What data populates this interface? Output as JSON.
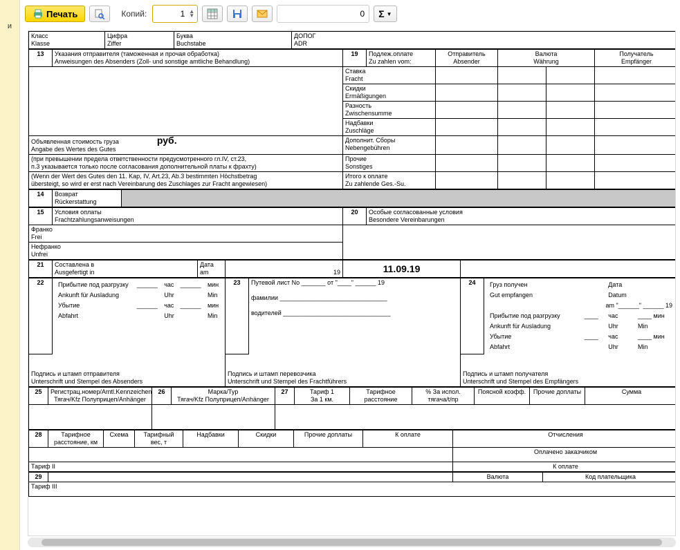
{
  "toolbar": {
    "print_label": "Печать",
    "copies_label": "Копий:",
    "copies_value": "1",
    "page_box_value": "0"
  },
  "left_tab": "и",
  "header_row": {
    "klass_ru": "Класс",
    "klass_de": "Klasse",
    "ziffer_ru": "Цифра",
    "ziffer_de": "Ziffer",
    "buchstabe_ru": "Буква",
    "buchstabe_de": "Buchstabe",
    "adr_ru": "ДОПОГ",
    "adr_de": "ADR"
  },
  "s13": {
    "num": "13",
    "ru": "Указания отправителя (таможенная и прочая обработка)",
    "de": "Anweisungen des Absenders (Zoll- und sonstige amtliche Behandlung)"
  },
  "s19": {
    "num": "19",
    "ru": "Подлеж.оплате",
    "de": "Zu zahlen vom:",
    "col_sender_ru": "Отправитель",
    "col_sender_de": "Absender",
    "col_curr_ru": "Валюта",
    "col_curr_de": "Währung",
    "col_recv_ru": "Получатель",
    "col_recv_de": "Empfänger",
    "rows": [
      {
        "ru": "Ставка",
        "de": "Fracht"
      },
      {
        "ru": "Скидки",
        "de": "Ermäßigungen"
      },
      {
        "ru": "Разность",
        "de": "Zwischensumme"
      },
      {
        "ru": "Надбавки",
        "de": "Zuschläge"
      },
      {
        "ru": "Дополнит. Сборы",
        "de": "Nebengebühren"
      },
      {
        "ru": "Прочие",
        "de": "Sonstiges"
      },
      {
        "ru": "Итого к оплате",
        "de": "Zu zahlende Ges.-Su."
      }
    ]
  },
  "declared": {
    "ru": "Объявленная стоимость груза",
    "de": "Angabe des Wertes des Gutes",
    "currency": "руб.",
    "note1_ru": "(при превышении предела ответственности предусмотренного гл.IV, ст.23,",
    "note1_ru2": "п.3 указывается только после согласования дополнительной платы к фрахту)",
    "note1_de": "(Wenn der Wert des Gutes den 11. Kap, IV, Art.23, Ab.3 bestimmten Höchstbetrag",
    "note1_de2": "übersteigt, so wird er erst nach Vereinbarung des Zuschlages zur Fracht angewiesen)"
  },
  "s14": {
    "num": "14",
    "ru": "Возврат",
    "de": "Rückerstattung"
  },
  "s15": {
    "num": "15",
    "ru": "Условия оплаты",
    "de": "Frachtzahlungsanweisungen",
    "franko_ru": "Франко",
    "franko_de": "Frei",
    "unfranko_ru": "Нефранко",
    "unfranko_de": "Unfrei"
  },
  "s20": {
    "num": "20",
    "ru": "Особые согласованные условия",
    "de": "Besondere Vereinbarungen"
  },
  "s21": {
    "num": "21",
    "ru": "Составлена в",
    "de": "Ausgefertigt in",
    "date_ru": "Дата",
    "date_de": "am",
    "year": "19",
    "date_value": "11.09.19"
  },
  "s22": {
    "num": "22",
    "arrive_ru": "Прибытие под разгрузку",
    "arrive_de": "Ankunft für Ausladung",
    "depart_ru": "Убытие",
    "depart_de": "Abfahrt",
    "hour_ru": "час",
    "hour_de": "Uhr",
    "min_ru": "мин",
    "min_de": "Min",
    "sign_ru": "Подпись и штамп отправителя",
    "sign_de": "Unterschrift und Stempel des Absenders"
  },
  "s23": {
    "num": "23",
    "waybill_ru": "Путевой лист No _______ от \"____\" ______ 19",
    "surname_ru": "фамилии",
    "driver_ru": "водителей",
    "sign_ru": "Подпись и штамп перевозчика",
    "sign_de": "Unterschrift und Stempel des Frachtführers"
  },
  "s24": {
    "num": "24",
    "ru": "Груз получен",
    "de": "Gut empfangen",
    "date_ru": "Дата",
    "date_de": "Datum",
    "at_de": "am \"______\" ______ 19",
    "arrive_ru": "Прибытие под разгрузку",
    "arrive_de": "Ankunft für Ausladung",
    "depart_ru": "Убытие",
    "depart_de": "Abfahrt",
    "hour_ru": "час",
    "hour_de": "Uhr",
    "min_ru": "мин",
    "min_de": "Min",
    "sign_ru": "Подпись и штамп получателя",
    "sign_de": "Unterschrift und Stempel des Empfängers"
  },
  "s25": {
    "num": "25",
    "ru": "Регистрац.номер/Amtl.Kennzeichen",
    "sub": "Тягач/Kfz  Полуприцеп/Anhänger"
  },
  "s26": {
    "num": "26",
    "ru": "Марка/Typ",
    "sub": "Тягач/Kfz Полуприцеп/Anhänger"
  },
  "s27": {
    "num": "27",
    "ru": "Тариф 1",
    "sub": "За 1 км.",
    "c2": "Тарифное расстояние",
    "c3": "% За испол. тягача/t/пр",
    "c4": "Поясной коэфф.",
    "c5": "Прочие доплаты",
    "c6": "Сумма"
  },
  "s28": {
    "num": "28",
    "c1": "Тарифное расстояние, км",
    "c2": "Схема",
    "c3": "Тарифный вес, т",
    "c4": "Надбавки",
    "c5": "Скидки",
    "c6": "Прочие доплаты",
    "c7": "К оплате",
    "r1": "Отчисления",
    "r2": "Оплачено заказчиком",
    "r3": "К оплате",
    "tarif2": "Тариф II"
  },
  "s29": {
    "num": "29",
    "c1": "Валюта",
    "c2": "Код плательщика",
    "tarif3": "Тариф III"
  }
}
